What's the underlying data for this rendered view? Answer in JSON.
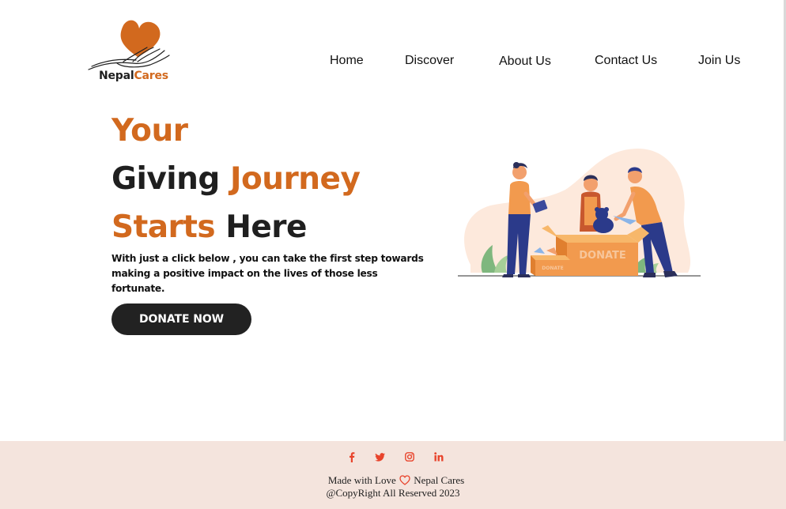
{
  "brand": {
    "name_part1": "Nepal",
    "name_part2": "Cares",
    "accent_color": "#d2691e",
    "logo_icon": "heart-in-hand-icon"
  },
  "nav": {
    "items": [
      {
        "label": "Home"
      },
      {
        "label": "Discover"
      },
      {
        "label": "About Us"
      },
      {
        "label": "Contact Us"
      },
      {
        "label": "Join Us"
      }
    ]
  },
  "hero": {
    "line1": "Your",
    "line2_dark": "Giving ",
    "line2_orange": "Journey",
    "line3_orange": "Starts",
    "line3_dark": " Here",
    "subtext": "With just a click below , you can take the first step towards making a positive impact on the lives of those less fortunate.",
    "cta_label": "DONATE NOW",
    "illustration_box_label": "DONATE",
    "illustration_small_box_label": "DONATE"
  },
  "footer": {
    "background": "#f4e4dd",
    "social_color": "#e8442c",
    "social_icons": [
      "facebook-icon",
      "twitter-icon",
      "instagram-icon",
      "linkedin-icon"
    ],
    "made_with": "Made with Love",
    "made_with_suffix": "Nepal Cares",
    "copyright": "@CopyRight All Reserved 2023"
  }
}
